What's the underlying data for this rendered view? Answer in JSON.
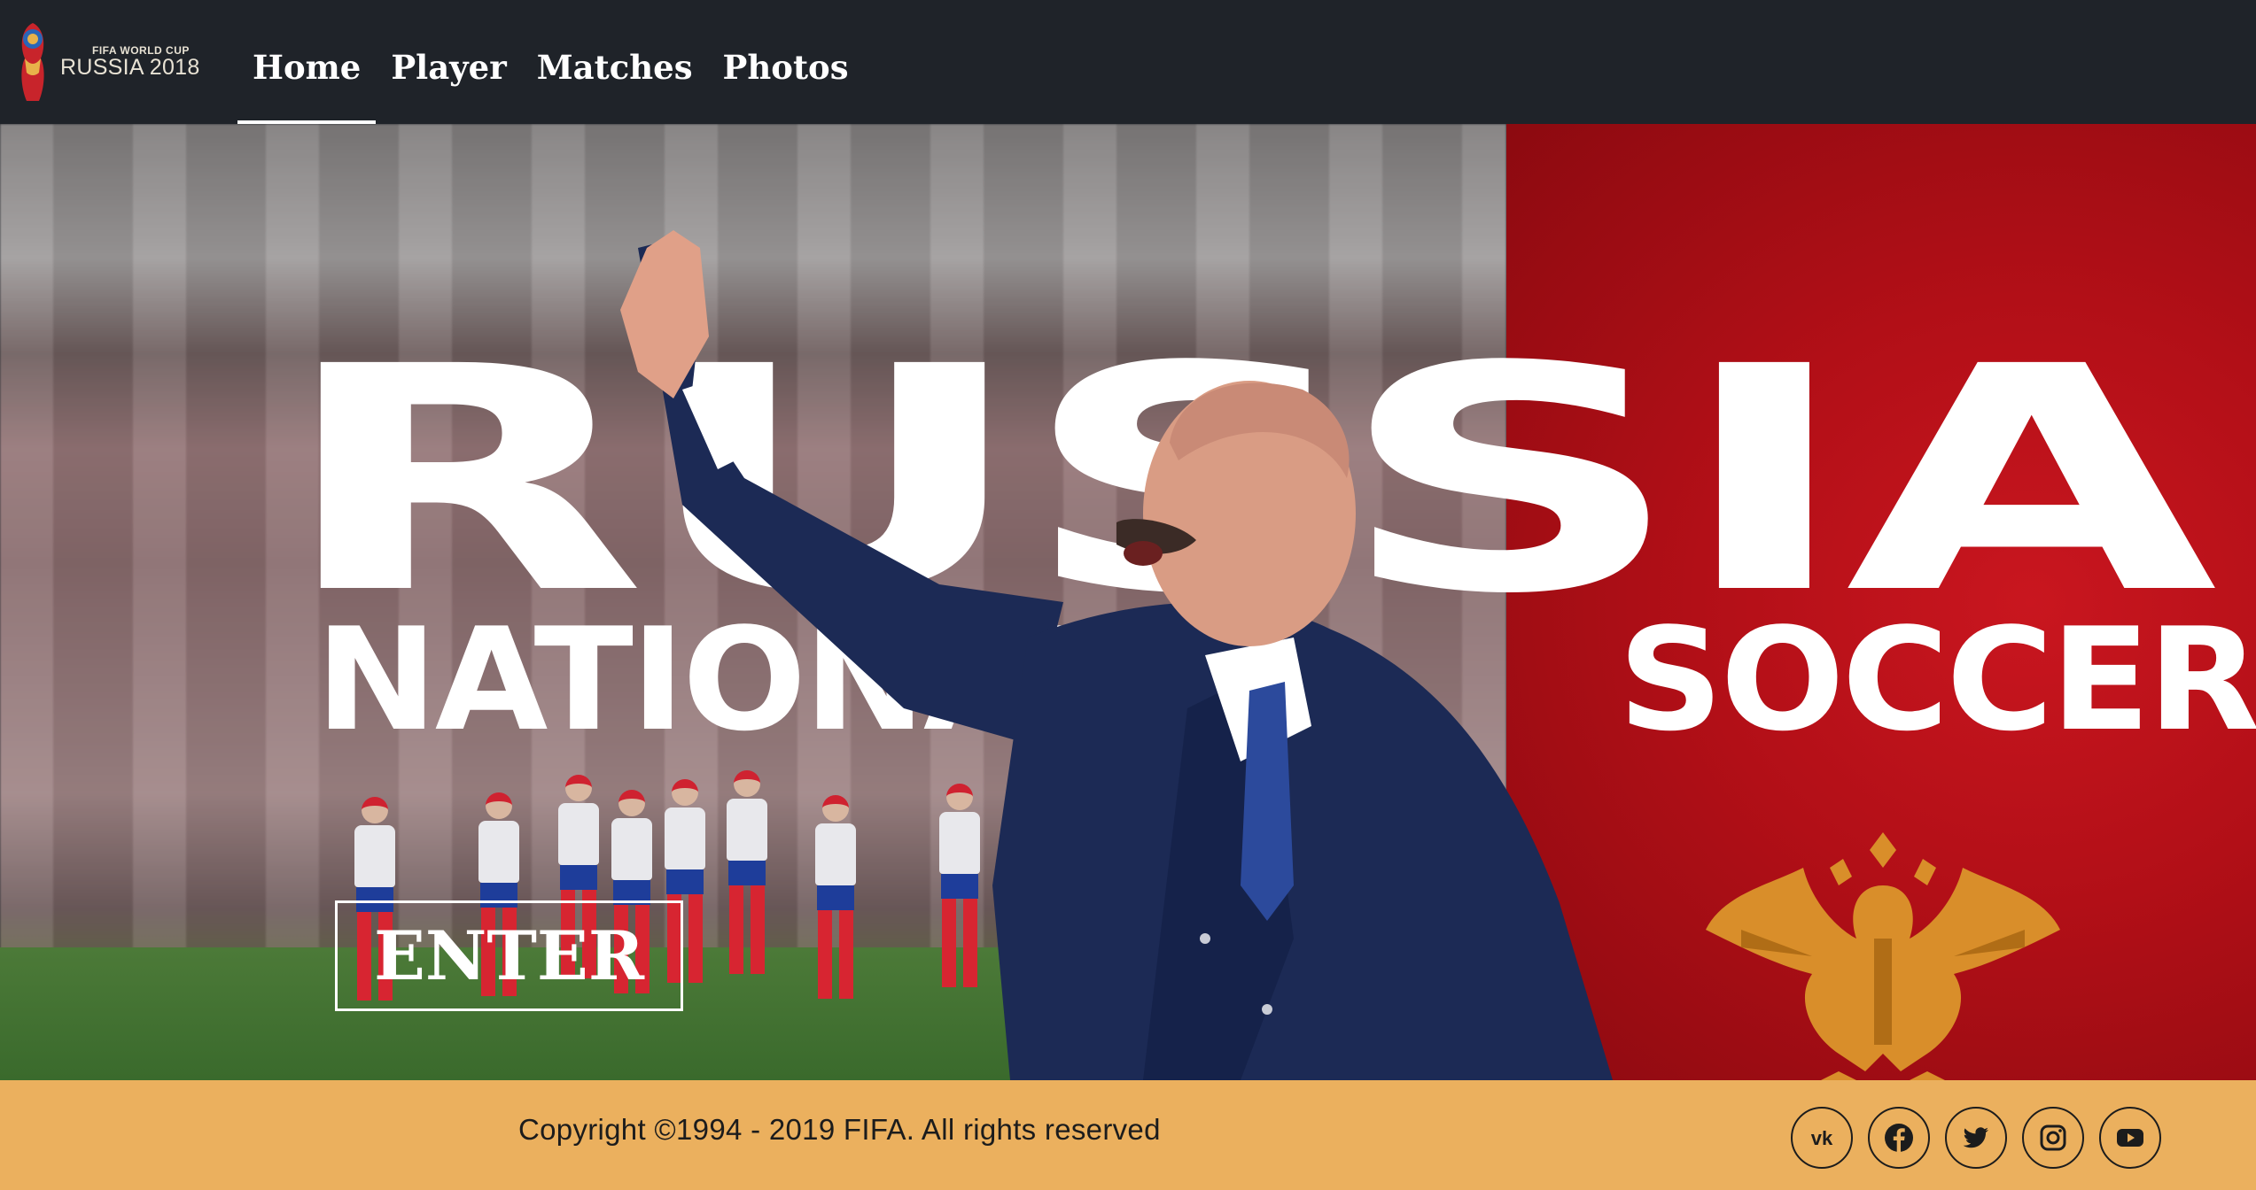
{
  "logo": {
    "small_text": "FIFA WORLD CUP",
    "big_text": "RUSSIA 2018"
  },
  "nav": {
    "items": [
      {
        "label": "Home",
        "active": true
      },
      {
        "label": "Player",
        "active": false
      },
      {
        "label": "Matches",
        "active": false
      },
      {
        "label": "Photos",
        "active": false
      }
    ]
  },
  "hero": {
    "title": "RUSSIA",
    "subtitle_left": "NATIONAL",
    "subtitle_right": "SOCCER",
    "enter_label": "ENTER"
  },
  "footer": {
    "copyright": "Copyright ©1994 - 2019 FIFA. All rights reserved",
    "socials": [
      {
        "icon": "vk-icon"
      },
      {
        "icon": "facebook-icon"
      },
      {
        "icon": "twitter-icon"
      },
      {
        "icon": "instagram-icon"
      },
      {
        "icon": "youtube-icon"
      }
    ]
  },
  "colors": {
    "navbar": "#1f2329",
    "footer": "#ebb05e",
    "hero_red": "#b20f17",
    "text_light": "#ffffff"
  }
}
